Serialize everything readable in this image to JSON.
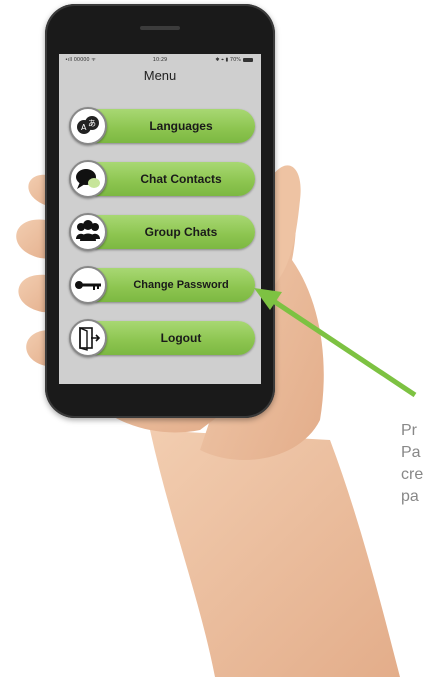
{
  "status_bar": {
    "carrier": "•ıll 00000 ᯤ",
    "time": "10:29",
    "battery": "✱ ⌖ ▮ 70%"
  },
  "menu": {
    "title": "Menu",
    "items": [
      {
        "label": "Languages",
        "icon": "languages-icon"
      },
      {
        "label": "Chat Contacts",
        "icon": "chat-bubble-icon"
      },
      {
        "label": "Group Chats",
        "icon": "group-icon"
      },
      {
        "label": "Change Password",
        "icon": "key-icon"
      },
      {
        "label": "Logout",
        "icon": "logout-door-icon"
      }
    ]
  },
  "annotation": {
    "lines": [
      "Pr",
      "Pa",
      "cre",
      "pa"
    ],
    "arrow_color": "#7dc242"
  },
  "colors": {
    "pill_green": "#8cc44f",
    "screen_bg": "#cfcfcf",
    "phone_body": "#1a1a1a"
  }
}
